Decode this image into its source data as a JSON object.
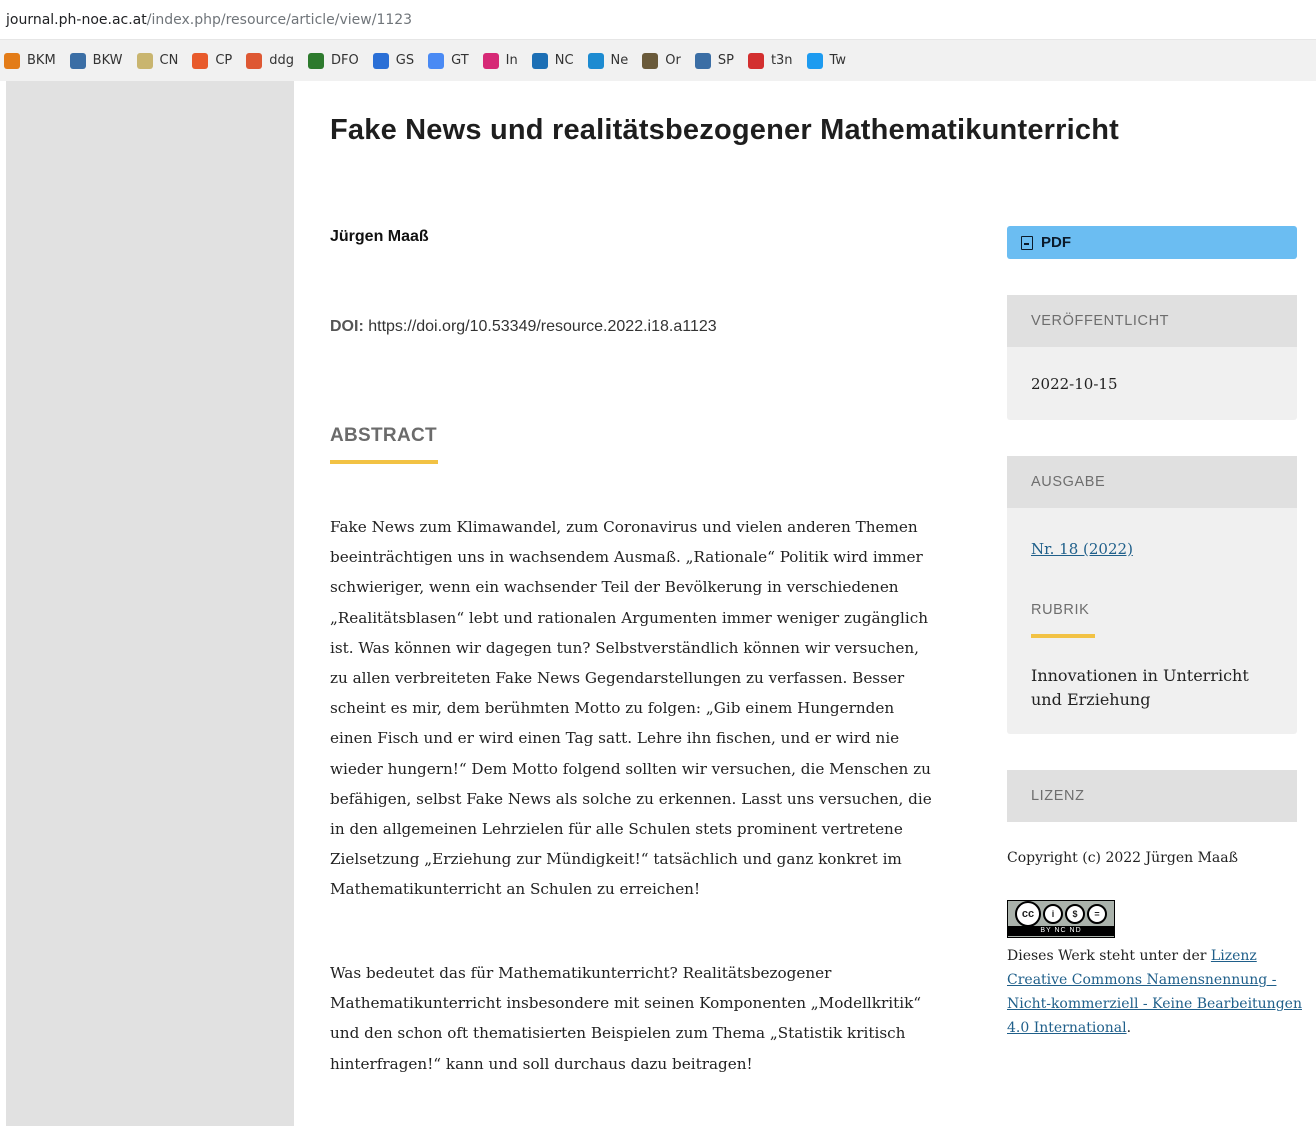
{
  "browser": {
    "url_host": "journal.ph-noe.ac.at",
    "url_path": "/index.php/resource/article/view/1123",
    "bookmarks": [
      {
        "label": "BKM",
        "icon": "orange-n-icon",
        "color": "#e37c18"
      },
      {
        "label": "BKW",
        "icon": "circle-blue-icon",
        "color": "#3b6ea5"
      },
      {
        "label": "CN",
        "icon": "map-icon",
        "color": "#c9b56f"
      },
      {
        "label": "CP",
        "icon": "signal-icon",
        "color": "#e85a2b"
      },
      {
        "label": "ddg",
        "icon": "duck-icon",
        "color": "#de5833"
      },
      {
        "label": "DFO",
        "icon": "crest-icon",
        "color": "#2d7a2d"
      },
      {
        "label": "GS",
        "icon": "diamond-icon",
        "color": "#2a6fd6"
      },
      {
        "label": "GT",
        "icon": "translate-icon",
        "color": "#4a8af4"
      },
      {
        "label": "In",
        "icon": "instagram-icon",
        "color": "#d62976"
      },
      {
        "label": "NC",
        "icon": "nc-icon",
        "color": "#1c6fb5"
      },
      {
        "label": "Ne",
        "icon": "arch-icon",
        "color": "#1d8bd1"
      },
      {
        "label": "Or",
        "icon": "photo-icon",
        "color": "#6a5a3a"
      },
      {
        "label": "SP",
        "icon": "circle-blue-icon",
        "color": "#3b6ea5"
      },
      {
        "label": "t3n",
        "icon": "t3n-icon",
        "color": "#d32f2f"
      },
      {
        "label": "Tw",
        "icon": "bird-icon",
        "color": "#1d9bf0"
      }
    ]
  },
  "article": {
    "title": "Fake News und realitätsbezogener Mathematikunterricht",
    "author": "Jürgen Maaß",
    "doi_label": "DOI:",
    "doi_value": "https://doi.org/10.53349/resource.2022.i18.a1123",
    "abstract_heading": "ABSTRACT",
    "abstract_p1": "Fake News zum Klimawandel, zum Coronavirus und vielen anderen Themen beeinträchtigen uns in wachsendem Ausmaß. „Rationale“ Politik wird immer schwieriger, wenn ein wachsender Teil der Bevölkerung in verschiedenen „Realitätsblasen“ lebt und rationalen Argumenten immer weniger zugänglich ist. Was können wir dagegen tun? Selbstverständlich können wir versuchen, zu allen verbreiteten Fake News Gegendarstellungen zu verfassen. Besser scheint es mir, dem berühmten Motto zu folgen: „Gib einem Hungernden einen Fisch und er wird einen Tag satt. Lehre ihn fischen, und er wird nie wieder hungern!“ Dem Motto folgend sollten wir versuchen, die Menschen zu befähigen, selbst Fake News als solche zu erkennen. Lasst uns versuchen, die in den allgemeinen Lehrzielen für alle Schulen stets prominent vertretene Zielsetzung „Erziehung zur Mündigkeit!“ tatsächlich und ganz konkret im Mathematikunterricht an Schulen zu erreichen!",
    "abstract_p2": "Was bedeutet das für Mathematikunterricht? Realitätsbezogener Mathematikunterricht insbesondere mit seinen Komponenten „Modellkritik“ und den schon oft thematisierten Beispielen zum Thema „Statistik kritisch hinterfragen!“ kann und soll durchaus dazu beitragen!"
  },
  "sidebar": {
    "pdf_label": "PDF",
    "published_heading": "VERÖFFENTLICHT",
    "published_date": "2022-10-15",
    "issue_heading": "AUSGABE",
    "issue_link": "Nr. 18 (2022)",
    "section_heading": "RUBRIK",
    "section_value": "Innovationen in Unterricht und Erziehung",
    "license_heading": "LIZENZ",
    "copyright": "Copyright (c) 2022 Jürgen Maaß",
    "cc_badge_bottom": "BY NC ND",
    "license_prefix": "Dieses Werk steht unter der ",
    "license_link": "Lizenz Creative Commons Namensnennung - Nicht-kommerziell - Keine Bearbeitungen 4.0 International",
    "license_suffix": "."
  }
}
